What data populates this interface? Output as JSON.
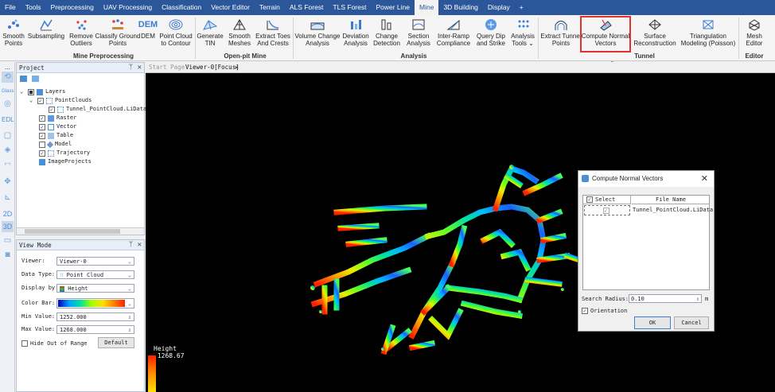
{
  "menubar": {
    "items": [
      {
        "label": "File"
      },
      {
        "label": "Tools"
      },
      {
        "label": "Preprocessing"
      },
      {
        "label": "UAV Processing"
      },
      {
        "label": "Classification"
      },
      {
        "label": "Vector Editor"
      },
      {
        "label": "Terrain"
      },
      {
        "label": "ALS Forest"
      },
      {
        "label": "TLS Forest"
      },
      {
        "label": "Power Line"
      },
      {
        "label": "Mine"
      },
      {
        "label": "3D Building"
      },
      {
        "label": "Display"
      },
      {
        "label": "+"
      }
    ],
    "active": "Mine"
  },
  "ribbon": {
    "buttons": [
      {
        "label": "Smooth\nPoints"
      },
      {
        "label": "Subsampling"
      },
      {
        "label": "Remove\nOutliers"
      },
      {
        "label": "Classify Ground\nPoints"
      },
      {
        "label": "DEM"
      },
      {
        "label": "Point Cloud\nto Contour"
      },
      {
        "label": "Generate\nTIN"
      },
      {
        "label": "Smooth\nMeshes"
      },
      {
        "label": "Extract Toes\nAnd Crests"
      },
      {
        "label": "Volume Change\nAnalysis"
      },
      {
        "label": "Deviation\nAnalysis"
      },
      {
        "label": "Change\nDetection"
      },
      {
        "label": "Section\nAnalysis"
      },
      {
        "label": "Inter-Ramp\nCompliance"
      },
      {
        "label": "Query Dip\nand Strike"
      },
      {
        "label": "Analysis\nTools ⌄"
      },
      {
        "label": "Extract Tunnel\nPoints"
      },
      {
        "label": "Compute Normal\nVectors"
      },
      {
        "label": "Surface\nReconstruction"
      },
      {
        "label": "Triangulation\nModeling (Poisson)"
      },
      {
        "label": "Mesh\nEditor"
      }
    ],
    "dem_badge": "DEM",
    "groups": {
      "mine_preprocessing": "Mine Preprocessing",
      "open_pit": "Open-pit Mine",
      "analysis": "Analysis",
      "tunnel": "Tunnel",
      "editor": "Editor"
    }
  },
  "toolstrip": {
    "glass": "Glass",
    "edl": "EDL",
    "two_d": "2D",
    "three_d": "3D"
  },
  "project_panel": {
    "title": "Project",
    "tree": {
      "layers": "Layers",
      "pointclouds": "PointClouds",
      "tunnel_file": "Tunnel_PointCloud.LiData",
      "raster": "Raster",
      "vector": "Vector",
      "table": "Table",
      "model": "Model",
      "trajectory": "Trajectory",
      "image_projects": "ImageProjects"
    }
  },
  "view_mode": {
    "title": "View Mode",
    "viewer_label": "Viewer:",
    "viewer_value": "Viewer-0",
    "data_type_label": "Data Type:",
    "data_type_value": "Point Cloud",
    "display_by_label": "Display by:",
    "display_by_value": "Height",
    "color_bar_label": "Color Bar:",
    "min_label": "Min Value:",
    "min_value": "1252.000",
    "max_label": "Max Value:",
    "max_value": "1268.000",
    "hide_out_of_range": "Hide Out of Range",
    "default_button": "Default"
  },
  "doc_tabs": {
    "start_page": "Start Page",
    "viewer_tab": "Viewer-0[Focus]",
    "close": "✕"
  },
  "legend": {
    "title": "Height",
    "value": "1268.67"
  },
  "dialog": {
    "title": "Compute Normal Vectors",
    "col_select": "Select",
    "col_file_name": "File Name",
    "row_file": "Tunnel_PointCloud.LiData",
    "search_radius_label": "Search Radius:",
    "search_radius_value": "0.10",
    "search_radius_unit": "m",
    "orientation_label": "Orientation",
    "ok": "OK",
    "cancel": "Cancel"
  }
}
